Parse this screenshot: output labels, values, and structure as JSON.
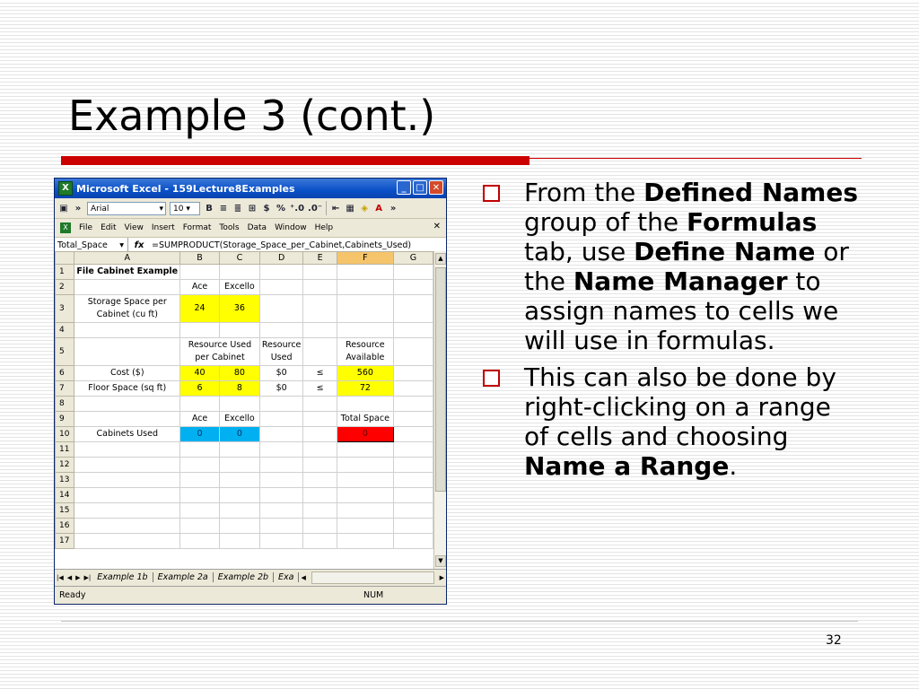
{
  "slide": {
    "title": "Example 3 (cont.)",
    "page_number": "32",
    "bullets": [
      {
        "parts": [
          {
            "text": "From the ",
            "bold": false
          },
          {
            "text": "Defined Names",
            "bold": true
          },
          {
            "text": " group of the ",
            "bold": false
          },
          {
            "text": "Formulas",
            "bold": true
          },
          {
            "text": " tab, use ",
            "bold": false
          },
          {
            "text": "Define Name",
            "bold": true
          },
          {
            "text": " or the ",
            "bold": false
          },
          {
            "text": "Name Manager",
            "bold": true
          },
          {
            "text": " to assign names to cells we will use in formulas.",
            "bold": false
          }
        ]
      },
      {
        "parts": [
          {
            "text": "This can also be done by right-clicking on a range of cells and choosing ",
            "bold": false
          },
          {
            "text": "Name a Range",
            "bold": true
          },
          {
            "text": ".",
            "bold": false
          }
        ]
      }
    ]
  },
  "excel": {
    "window_title": "Microsoft Excel - 159Lecture8Examples",
    "toolbar": {
      "font": "Arial",
      "font_size": "10",
      "bold": "B",
      "currency": "$",
      "percent": "%",
      "dec_inc": "⁺.0",
      "dec_dec": ".0⁻"
    },
    "menu": [
      "File",
      "Edit",
      "View",
      "Insert",
      "Format",
      "Tools",
      "Data",
      "Window",
      "Help"
    ],
    "name_box": "Total_Space",
    "fx": "fx",
    "formula": "=SUMPRODUCT(Storage_Space_per_Cabinet,Cabinets_Used)",
    "columns": [
      "A",
      "B",
      "C",
      "D",
      "E",
      "F",
      "G"
    ],
    "rows": [
      {
        "n": "1",
        "cells": [
          {
            "v": "File Cabinet Example",
            "cls": "bold"
          },
          {
            "v": ""
          },
          {
            "v": ""
          },
          {
            "v": ""
          },
          {
            "v": ""
          },
          {
            "v": ""
          },
          {
            "v": ""
          }
        ]
      },
      {
        "n": "2",
        "cells": [
          {
            "v": ""
          },
          {
            "v": "Ace"
          },
          {
            "v": "Excello"
          },
          {
            "v": ""
          },
          {
            "v": ""
          },
          {
            "v": ""
          },
          {
            "v": ""
          }
        ]
      },
      {
        "n": "3",
        "tall": true,
        "cells": [
          {
            "v": "Storage Space per Cabinet (cu ft)"
          },
          {
            "v": "24",
            "cls": "yellow"
          },
          {
            "v": "36",
            "cls": "yellow"
          },
          {
            "v": ""
          },
          {
            "v": ""
          },
          {
            "v": ""
          },
          {
            "v": ""
          }
        ]
      },
      {
        "n": "4",
        "cells": [
          {
            "v": ""
          },
          {
            "v": ""
          },
          {
            "v": ""
          },
          {
            "v": ""
          },
          {
            "v": ""
          },
          {
            "v": ""
          },
          {
            "v": ""
          }
        ]
      },
      {
        "n": "5",
        "tall": true,
        "cells": [
          {
            "v": ""
          },
          {
            "v": "Resource Used per Cabinet",
            "span": 2
          },
          {
            "v": "Resource Used"
          },
          {
            "v": ""
          },
          {
            "v": "Resource Available"
          },
          {
            "v": ""
          }
        ]
      },
      {
        "n": "6",
        "cells": [
          {
            "v": "Cost ($)"
          },
          {
            "v": "40",
            "cls": "yellow"
          },
          {
            "v": "80",
            "cls": "yellow"
          },
          {
            "v": "$0"
          },
          {
            "v": "≤"
          },
          {
            "v": "560",
            "cls": "yellow"
          },
          {
            "v": ""
          }
        ]
      },
      {
        "n": "7",
        "cells": [
          {
            "v": "Floor Space (sq ft)"
          },
          {
            "v": "6",
            "cls": "yellow"
          },
          {
            "v": "8",
            "cls": "yellow"
          },
          {
            "v": "$0"
          },
          {
            "v": "≤"
          },
          {
            "v": "72",
            "cls": "yellow"
          },
          {
            "v": ""
          }
        ]
      },
      {
        "n": "8",
        "cells": [
          {
            "v": ""
          },
          {
            "v": ""
          },
          {
            "v": ""
          },
          {
            "v": ""
          },
          {
            "v": ""
          },
          {
            "v": ""
          },
          {
            "v": ""
          }
        ]
      },
      {
        "n": "9",
        "cells": [
          {
            "v": ""
          },
          {
            "v": "Ace"
          },
          {
            "v": "Excello"
          },
          {
            "v": ""
          },
          {
            "v": ""
          },
          {
            "v": "Total Space"
          },
          {
            "v": ""
          }
        ]
      },
      {
        "n": "10",
        "cells": [
          {
            "v": "Cabinets Used"
          },
          {
            "v": "0",
            "cls": "cyan"
          },
          {
            "v": "0",
            "cls": "cyan"
          },
          {
            "v": ""
          },
          {
            "v": ""
          },
          {
            "v": "0",
            "cls": "red"
          },
          {
            "v": ""
          }
        ]
      },
      {
        "n": "11",
        "cells": [
          {
            "v": ""
          },
          {
            "v": ""
          },
          {
            "v": ""
          },
          {
            "v": ""
          },
          {
            "v": ""
          },
          {
            "v": ""
          },
          {
            "v": ""
          }
        ]
      },
      {
        "n": "12",
        "cells": [
          {
            "v": ""
          },
          {
            "v": ""
          },
          {
            "v": ""
          },
          {
            "v": ""
          },
          {
            "v": ""
          },
          {
            "v": ""
          },
          {
            "v": ""
          }
        ]
      },
      {
        "n": "13",
        "cells": [
          {
            "v": ""
          },
          {
            "v": ""
          },
          {
            "v": ""
          },
          {
            "v": ""
          },
          {
            "v": ""
          },
          {
            "v": ""
          },
          {
            "v": ""
          }
        ]
      },
      {
        "n": "14",
        "cells": [
          {
            "v": ""
          },
          {
            "v": ""
          },
          {
            "v": ""
          },
          {
            "v": ""
          },
          {
            "v": ""
          },
          {
            "v": ""
          },
          {
            "v": ""
          }
        ]
      },
      {
        "n": "15",
        "cells": [
          {
            "v": ""
          },
          {
            "v": ""
          },
          {
            "v": ""
          },
          {
            "v": ""
          },
          {
            "v": ""
          },
          {
            "v": ""
          },
          {
            "v": ""
          }
        ]
      },
      {
        "n": "16",
        "cells": [
          {
            "v": ""
          },
          {
            "v": ""
          },
          {
            "v": ""
          },
          {
            "v": ""
          },
          {
            "v": ""
          },
          {
            "v": ""
          },
          {
            "v": ""
          }
        ]
      },
      {
        "n": "17",
        "cells": [
          {
            "v": ""
          },
          {
            "v": ""
          },
          {
            "v": ""
          },
          {
            "v": ""
          },
          {
            "v": ""
          },
          {
            "v": ""
          },
          {
            "v": ""
          }
        ]
      }
    ],
    "sheet_tabs": [
      "Example 1b",
      "Example 2a",
      "Example 2b",
      "Exa"
    ],
    "status_left": "Ready",
    "status_right": "NUM",
    "colors": {
      "selection": "#ff0000",
      "changing_cells": "#00b0f0",
      "data_cells": "#ffff00",
      "titlebar": "#0a50c8"
    }
  }
}
